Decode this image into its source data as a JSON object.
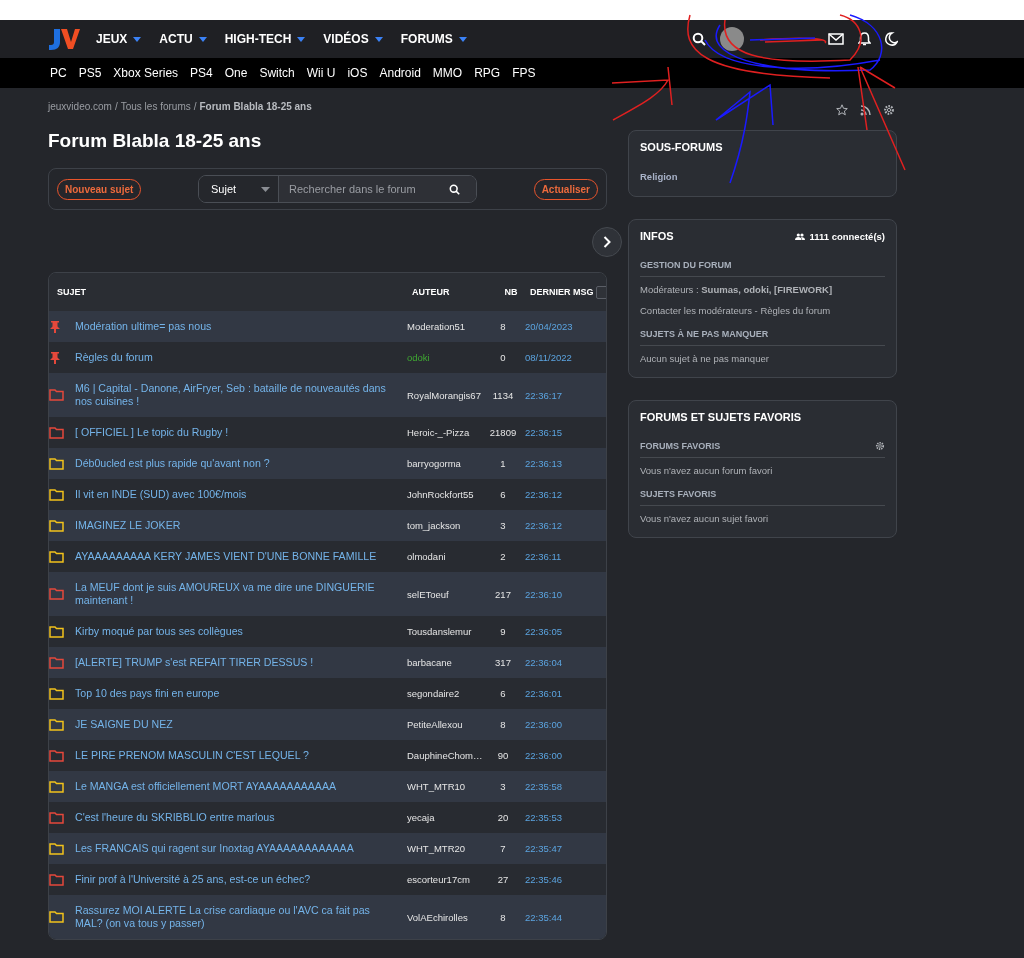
{
  "header": {
    "nav": [
      "JEUX",
      "ACTU",
      "HIGH-TECH",
      "VIDÉOS",
      "FORUMS"
    ]
  },
  "subnav": [
    "PC",
    "PS5",
    "Xbox Series",
    "PS4",
    "One",
    "Switch",
    "Wii U",
    "iOS",
    "Android",
    "MMO",
    "RPG",
    "FPS"
  ],
  "breadcrumb": {
    "links": [
      "jeuxvideo.com",
      "Tous les forums"
    ],
    "current": "Forum Blabla 18-25 ans",
    "separator": "/"
  },
  "title": "Forum Blabla 18-25 ans",
  "toolbar": {
    "new_topic": "Nouveau sujet",
    "search_scope": "Sujet",
    "search_placeholder": "Rechercher dans le forum",
    "refresh": "Actualiser"
  },
  "table": {
    "columns": [
      "SUJET",
      "AUTEUR",
      "NB",
      "DERNIER MSG"
    ],
    "select_all_checked": false,
    "rows": [
      {
        "kind": "pinned",
        "title": "Modération ultime= pas nous",
        "author": "Moderation51",
        "author_moderator": false,
        "count": "8",
        "last": "20/04/2023"
      },
      {
        "kind": "pinned",
        "title": "Règles du forum",
        "author": "odoki",
        "author_moderator": true,
        "count": "0",
        "last": "08/11/2022"
      },
      {
        "kind": "hot",
        "title": "M6 | Capital - Danone, AirFryer, Seb : bataille de nouveautés dans nos cuisines !",
        "author": "RoyalMorangis67",
        "author_moderator": false,
        "count": "1134",
        "last": "22:36:17"
      },
      {
        "kind": "hot",
        "title": "[ OFFICIEL ] Le topic du Rugby !",
        "author": "Heroic-_-Pizza",
        "author_moderator": false,
        "count": "21809",
        "last": "22:36:15"
      },
      {
        "kind": "normal",
        "title": "Déb0ucled est plus rapide qu'avant non ?",
        "author": "barryogorma",
        "author_moderator": false,
        "count": "1",
        "last": "22:36:13"
      },
      {
        "kind": "normal",
        "title": "Il vit en INDE (SUD) avec 100€/mois",
        "author": "JohnRockfort55",
        "author_moderator": false,
        "count": "6",
        "last": "22:36:12"
      },
      {
        "kind": "normal",
        "title": "IMAGINEZ LE JOKER",
        "author": "tom_jackson",
        "author_moderator": false,
        "count": "3",
        "last": "22:36:12"
      },
      {
        "kind": "normal",
        "title": "AYAAAAAAAAA KERY JAMES VIENT D'UNE BONNE FAMILLE",
        "author": "olmodani",
        "author_moderator": false,
        "count": "2",
        "last": "22:36:11"
      },
      {
        "kind": "hot",
        "title": "La MEUF dont je suis AMOUREUX va me dire une DINGUERIE maintenant !",
        "author": "selEToeuf",
        "author_moderator": false,
        "count": "217",
        "last": "22:36:10"
      },
      {
        "kind": "normal",
        "title": "Kirby moqué par tous ses collègues",
        "author": "Tousdanslemur",
        "author_moderator": false,
        "count": "9",
        "last": "22:36:05"
      },
      {
        "kind": "hot",
        "title": "[ALERTE] TRUMP s'est REFAIT TIRER DESSUS !",
        "author": "barbacane",
        "author_moderator": false,
        "count": "317",
        "last": "22:36:04"
      },
      {
        "kind": "normal",
        "title": "Top 10 des pays fini en europe",
        "author": "segondaire2",
        "author_moderator": false,
        "count": "6",
        "last": "22:36:01"
      },
      {
        "kind": "normal",
        "title": "JE SAIGNE DU NEZ",
        "author": "PetiteAllexou",
        "author_moderator": false,
        "count": "8",
        "last": "22:36:00"
      },
      {
        "kind": "hot",
        "title": "LE PIRE PRENOM MASCULIN C'EST LEQUEL ?",
        "author": "DauphineChom…",
        "author_moderator": false,
        "count": "90",
        "last": "22:36:00"
      },
      {
        "kind": "normal",
        "title": "Le MANGA est officiellement MORT AYAAAAAAAAAAA",
        "author": "WHT_MTR10",
        "author_moderator": false,
        "count": "3",
        "last": "22:35:58"
      },
      {
        "kind": "hot",
        "title": "C'est l'heure du SKRIBBLIO entre marlous",
        "author": "yecaja",
        "author_moderator": false,
        "count": "20",
        "last": "22:35:53"
      },
      {
        "kind": "normal",
        "title": "Les FRANCAIS qui ragent sur Inoxtag AYAAAAAAAAAAAA",
        "author": "WHT_MTR20",
        "author_moderator": false,
        "count": "7",
        "last": "22:35:47"
      },
      {
        "kind": "hot",
        "title": "Finir prof à l'Université à 25 ans, est-ce un échec?",
        "author": "escorteur17cm",
        "author_moderator": false,
        "count": "27",
        "last": "22:35:46"
      },
      {
        "kind": "normal",
        "title": "Rassurez MOI ALERTE La crise cardiaque ou l'AVC ca fait pas MAL? (on va tous y passer)",
        "author": "VolAEchirolles",
        "author_moderator": false,
        "count": "8",
        "last": "22:35:44"
      }
    ]
  },
  "sous_forums": {
    "title": "SOUS-FORUMS",
    "items": [
      "Religion"
    ]
  },
  "infos": {
    "title": "INFOS",
    "connected": "1111 connecté(s)",
    "sections": [
      {
        "heading": "GESTION DU FORUM",
        "lines": [
          "Modérateurs : **Suumas, odoki, [FIREWORK]**",
          "Contacter les modérateurs - Règles du forum"
        ]
      },
      {
        "heading": "SUJETS À NE PAS MANQUER",
        "lines": [
          "Aucun sujet à ne pas manquer"
        ]
      }
    ]
  },
  "favoris": {
    "title": "FORUMS ET SUJETS FAVORIS",
    "sections": [
      {
        "heading": "FORUMS FAVORIS",
        "settings": true,
        "text": "Vous n'avez aucun forum favori"
      },
      {
        "heading": "SUJETS FAVORIS",
        "settings": false,
        "text": "Vous n'avez aucun sujet favori"
      }
    ]
  }
}
